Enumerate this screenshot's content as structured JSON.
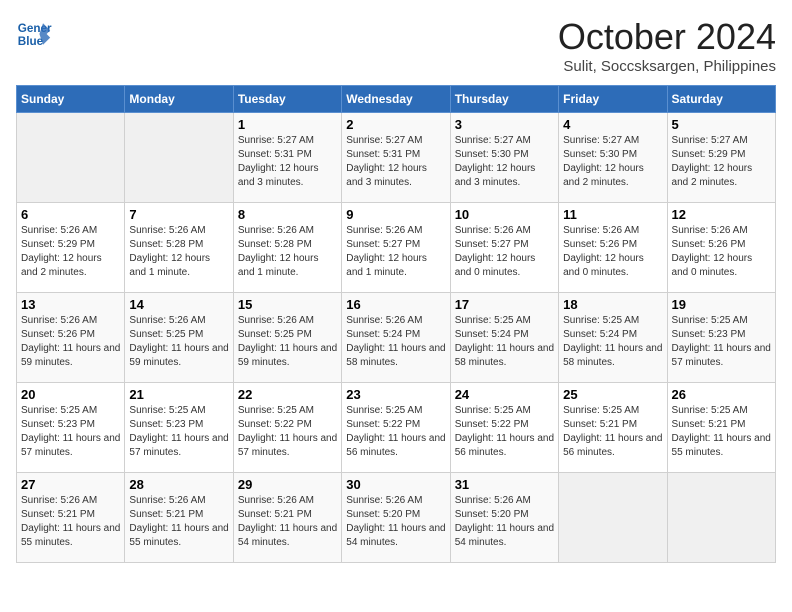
{
  "logo": {
    "line1": "General",
    "line2": "Blue"
  },
  "title": "October 2024",
  "subtitle": "Sulit, Soccsksargen, Philippines",
  "weekdays": [
    "Sunday",
    "Monday",
    "Tuesday",
    "Wednesday",
    "Thursday",
    "Friday",
    "Saturday"
  ],
  "weeks": [
    [
      {
        "day": "",
        "info": ""
      },
      {
        "day": "",
        "info": ""
      },
      {
        "day": "1",
        "info": "Sunrise: 5:27 AM\nSunset: 5:31 PM\nDaylight: 12 hours and 3 minutes."
      },
      {
        "day": "2",
        "info": "Sunrise: 5:27 AM\nSunset: 5:31 PM\nDaylight: 12 hours and 3 minutes."
      },
      {
        "day": "3",
        "info": "Sunrise: 5:27 AM\nSunset: 5:30 PM\nDaylight: 12 hours and 3 minutes."
      },
      {
        "day": "4",
        "info": "Sunrise: 5:27 AM\nSunset: 5:30 PM\nDaylight: 12 hours and 2 minutes."
      },
      {
        "day": "5",
        "info": "Sunrise: 5:27 AM\nSunset: 5:29 PM\nDaylight: 12 hours and 2 minutes."
      }
    ],
    [
      {
        "day": "6",
        "info": "Sunrise: 5:26 AM\nSunset: 5:29 PM\nDaylight: 12 hours and 2 minutes."
      },
      {
        "day": "7",
        "info": "Sunrise: 5:26 AM\nSunset: 5:28 PM\nDaylight: 12 hours and 1 minute."
      },
      {
        "day": "8",
        "info": "Sunrise: 5:26 AM\nSunset: 5:28 PM\nDaylight: 12 hours and 1 minute."
      },
      {
        "day": "9",
        "info": "Sunrise: 5:26 AM\nSunset: 5:27 PM\nDaylight: 12 hours and 1 minute."
      },
      {
        "day": "10",
        "info": "Sunrise: 5:26 AM\nSunset: 5:27 PM\nDaylight: 12 hours and 0 minutes."
      },
      {
        "day": "11",
        "info": "Sunrise: 5:26 AM\nSunset: 5:26 PM\nDaylight: 12 hours and 0 minutes."
      },
      {
        "day": "12",
        "info": "Sunrise: 5:26 AM\nSunset: 5:26 PM\nDaylight: 12 hours and 0 minutes."
      }
    ],
    [
      {
        "day": "13",
        "info": "Sunrise: 5:26 AM\nSunset: 5:26 PM\nDaylight: 11 hours and 59 minutes."
      },
      {
        "day": "14",
        "info": "Sunrise: 5:26 AM\nSunset: 5:25 PM\nDaylight: 11 hours and 59 minutes."
      },
      {
        "day": "15",
        "info": "Sunrise: 5:26 AM\nSunset: 5:25 PM\nDaylight: 11 hours and 59 minutes."
      },
      {
        "day": "16",
        "info": "Sunrise: 5:26 AM\nSunset: 5:24 PM\nDaylight: 11 hours and 58 minutes."
      },
      {
        "day": "17",
        "info": "Sunrise: 5:25 AM\nSunset: 5:24 PM\nDaylight: 11 hours and 58 minutes."
      },
      {
        "day": "18",
        "info": "Sunrise: 5:25 AM\nSunset: 5:24 PM\nDaylight: 11 hours and 58 minutes."
      },
      {
        "day": "19",
        "info": "Sunrise: 5:25 AM\nSunset: 5:23 PM\nDaylight: 11 hours and 57 minutes."
      }
    ],
    [
      {
        "day": "20",
        "info": "Sunrise: 5:25 AM\nSunset: 5:23 PM\nDaylight: 11 hours and 57 minutes."
      },
      {
        "day": "21",
        "info": "Sunrise: 5:25 AM\nSunset: 5:23 PM\nDaylight: 11 hours and 57 minutes."
      },
      {
        "day": "22",
        "info": "Sunrise: 5:25 AM\nSunset: 5:22 PM\nDaylight: 11 hours and 57 minutes."
      },
      {
        "day": "23",
        "info": "Sunrise: 5:25 AM\nSunset: 5:22 PM\nDaylight: 11 hours and 56 minutes."
      },
      {
        "day": "24",
        "info": "Sunrise: 5:25 AM\nSunset: 5:22 PM\nDaylight: 11 hours and 56 minutes."
      },
      {
        "day": "25",
        "info": "Sunrise: 5:25 AM\nSunset: 5:21 PM\nDaylight: 11 hours and 56 minutes."
      },
      {
        "day": "26",
        "info": "Sunrise: 5:25 AM\nSunset: 5:21 PM\nDaylight: 11 hours and 55 minutes."
      }
    ],
    [
      {
        "day": "27",
        "info": "Sunrise: 5:26 AM\nSunset: 5:21 PM\nDaylight: 11 hours and 55 minutes."
      },
      {
        "day": "28",
        "info": "Sunrise: 5:26 AM\nSunset: 5:21 PM\nDaylight: 11 hours and 55 minutes."
      },
      {
        "day": "29",
        "info": "Sunrise: 5:26 AM\nSunset: 5:21 PM\nDaylight: 11 hours and 54 minutes."
      },
      {
        "day": "30",
        "info": "Sunrise: 5:26 AM\nSunset: 5:20 PM\nDaylight: 11 hours and 54 minutes."
      },
      {
        "day": "31",
        "info": "Sunrise: 5:26 AM\nSunset: 5:20 PM\nDaylight: 11 hours and 54 minutes."
      },
      {
        "day": "",
        "info": ""
      },
      {
        "day": "",
        "info": ""
      }
    ]
  ]
}
